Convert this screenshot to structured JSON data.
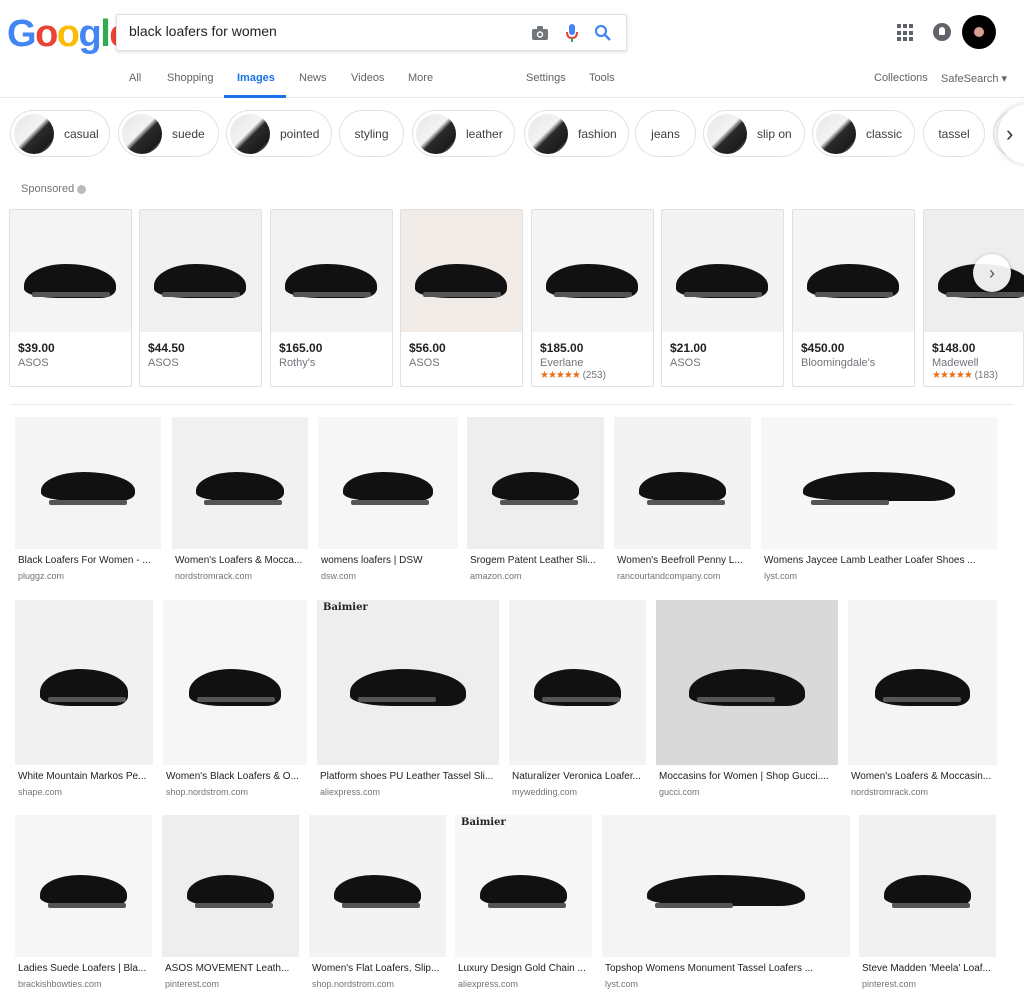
{
  "logo": "Google",
  "logo_colors": [
    "#4285f4",
    "#ea4335",
    "#fbbc05",
    "#4285f4",
    "#34a853",
    "#ea4335"
  ],
  "search": {
    "value": "black loafers for women"
  },
  "icons": {
    "camera": "camera-icon",
    "mic": "microphone-icon",
    "search": "search-icon",
    "apps": "apps-grid-icon",
    "notifications": "notification-bell-icon",
    "avatar": "account-avatar"
  },
  "tabs": {
    "all": "All",
    "shopping": "Shopping",
    "images": "Images",
    "news": "News",
    "videos": "Videos",
    "more": "More",
    "settings": "Settings",
    "tools": "Tools",
    "collections": "Collections",
    "safesearch": "SafeSearch ▾"
  },
  "accent_color": "#1a73e8",
  "chips": [
    "casual",
    "suede",
    "pointed",
    "styling",
    "leather",
    "fashion",
    "jeans",
    "slip on",
    "classic",
    "tassel"
  ],
  "sponsored_label": "Sponsored",
  "ads": [
    {
      "price": "$39.00",
      "store": "ASOS",
      "rating": ""
    },
    {
      "price": "$44.50",
      "store": "ASOS",
      "rating": ""
    },
    {
      "price": "$165.00",
      "store": "Rothy's",
      "rating": ""
    },
    {
      "price": "$56.00",
      "store": "ASOS",
      "rating": ""
    },
    {
      "price": "$185.00",
      "store": "Everlane",
      "rating": "★★★★★ (253)"
    },
    {
      "price": "$21.00",
      "store": "ASOS",
      "rating": ""
    },
    {
      "price": "$450.00",
      "store": "Bloomingdale's",
      "rating": ""
    },
    {
      "price": "$148.00",
      "store": "Madewell",
      "rating": "★★★★★ (183)"
    }
  ],
  "results": [
    [
      {
        "title": "Black Loafers For Women - ...",
        "domain": "pluggz.com"
      },
      {
        "title": "Women's Loafers & Mocca...",
        "domain": "nordstromrack.com"
      },
      {
        "title": "womens loafers | DSW",
        "domain": "dsw.com"
      },
      {
        "title": "Srogem Patent Leather Sli...",
        "domain": "amazon.com"
      },
      {
        "title": "Women's Beefroll Penny L...",
        "domain": "rancourtandcompany.com"
      },
      {
        "title": "Womens Jaycee Lamb Leather Loafer Shoes ...",
        "domain": "lyst.com"
      }
    ],
    [
      {
        "title": "White Mountain Markos Pe...",
        "domain": "shape.com"
      },
      {
        "title": "Women's Black Loafers & O...",
        "domain": "shop.nordstrom.com"
      },
      {
        "title": "Platform shoes PU Leather Tassel Sli...",
        "domain": "aliexpress.com"
      },
      {
        "title": "Naturalizer Veronica Loafer...",
        "domain": "mywedding.com"
      },
      {
        "title": "Moccasins for Women | Shop Gucci....",
        "domain": "gucci.com"
      },
      {
        "title": "Women's Loafers & Moccasin...",
        "domain": "nordstromrack.com"
      }
    ],
    [
      {
        "title": "Ladies Suede Loafers | Bla...",
        "domain": "brackishbowties.com"
      },
      {
        "title": "ASOS MOVEMENT Leath...",
        "domain": "pinterest.com"
      },
      {
        "title": "Women's Flat Loafers, Slip...",
        "domain": "shop.nordstrom.com"
      },
      {
        "title": "Luxury Design Gold Chain ...",
        "domain": "aliexpress.com"
      },
      {
        "title": "Topshop Womens Monument Tassel Loafers ...",
        "domain": "lyst.com"
      },
      {
        "title": "Steve Madden 'Meela' Loaf...",
        "domain": "pinterest.com"
      }
    ]
  ],
  "watermark": "Baimier"
}
